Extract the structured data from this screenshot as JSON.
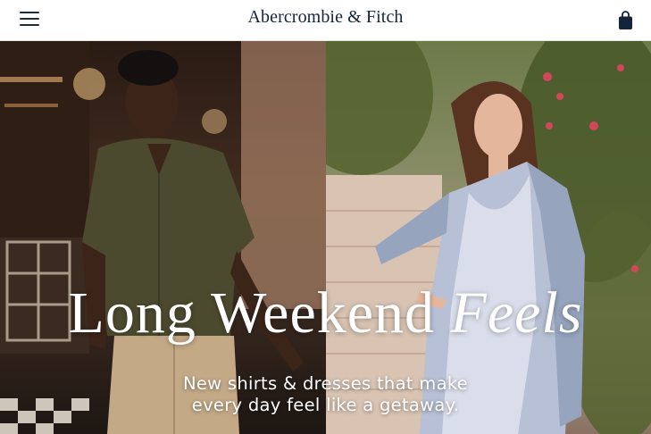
{
  "header": {
    "logo": "Abercrombie & Fitch",
    "menu_icon": "hamburger-menu-icon",
    "bag_icon": "shopping-bag-icon"
  },
  "hero": {
    "headline_main": "Long Weekend ",
    "headline_accent": "Feels",
    "subtext_line1": "New shirts & dresses that make",
    "subtext_line2": "every day feel like a getaway."
  },
  "colors": {
    "brand_navy": "#14253b",
    "hero_text": "#ffffff"
  }
}
